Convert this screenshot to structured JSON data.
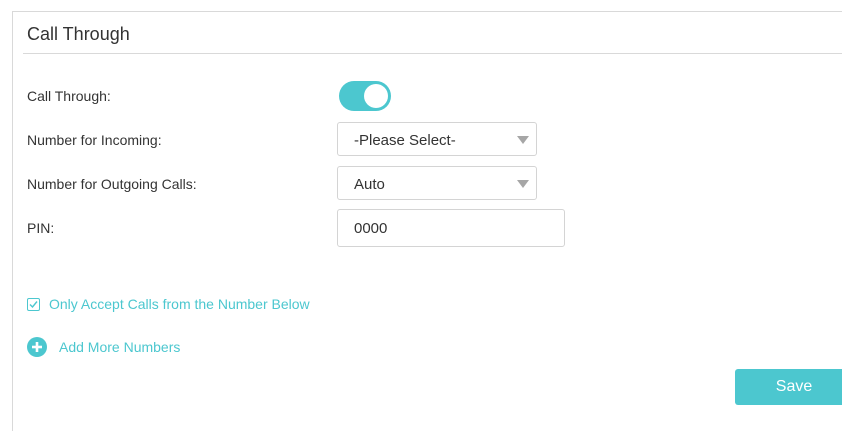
{
  "section": {
    "title": "Call Through"
  },
  "fields": {
    "call_through": {
      "label": "Call Through:",
      "enabled": true
    },
    "incoming": {
      "label": "Number for Incoming:",
      "value": "-Please Select-"
    },
    "outgoing": {
      "label": "Number for Outgoing Calls:",
      "value": "Auto"
    },
    "pin": {
      "label": "PIN:",
      "value": "0000"
    }
  },
  "options": {
    "only_accept_label": "Only Accept Calls from the Number Below",
    "only_accept_checked": true,
    "add_more_label": "Add More Numbers"
  },
  "actions": {
    "save_label": "Save"
  },
  "colors": {
    "accent": "#4cc7cf",
    "border": "#d4d4d4",
    "text": "#333333"
  },
  "icons": {
    "toggle": "toggle-switch-icon",
    "dropdown": "chevron-down-icon",
    "checkbox": "checkmark-icon",
    "add": "plus-circle-icon"
  }
}
